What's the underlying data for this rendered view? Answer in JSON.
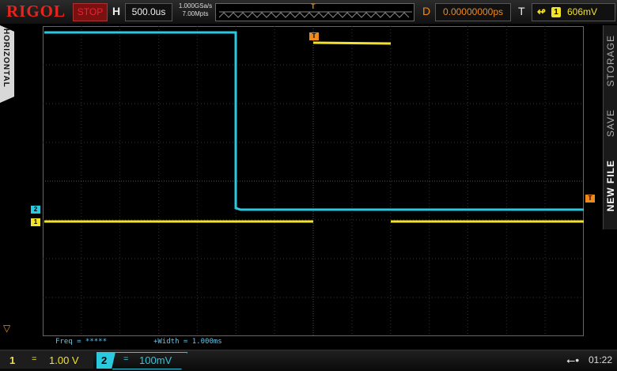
{
  "header": {
    "brand": "RIGOL",
    "run_state": "STOP",
    "h_label": "H",
    "timebase": "500.0us",
    "sample_rate": "1.000GSa/s",
    "memory_depth": "7.00Mpts",
    "memory_trigger_marker": "T",
    "d_label": "D",
    "delay": "0.00000000ps",
    "t_label": "T",
    "trigger_edge_icon": "rising-edge-icon",
    "trigger_source": "1",
    "trigger_level": "606mV"
  },
  "side_left": {
    "label": "HORIZONTAL"
  },
  "side_right": {
    "new_file": "NEW FILE",
    "save": "SAVE",
    "storage": "STORAGE"
  },
  "markers": {
    "ch2": "2",
    "ch1": "1",
    "trigger_top": "T",
    "trigger_right": "T"
  },
  "measurements": {
    "freq": "Freq = *****",
    "width": "+Width = 1.000ms"
  },
  "channels": [
    {
      "num": "1",
      "coupling": "=",
      "scale": "1.00 V",
      "color": "#f2e22a"
    },
    {
      "num": "2",
      "coupling": "=",
      "scale": "100mV",
      "color": "#2bc9df"
    }
  ],
  "status": {
    "usb_icon": "usb-icon",
    "time": "01:22"
  },
  "colors": {
    "accent": "#f08a1c",
    "ch1": "#f2e22a",
    "ch2": "#2bc9df",
    "brand": "#e8251d"
  }
}
